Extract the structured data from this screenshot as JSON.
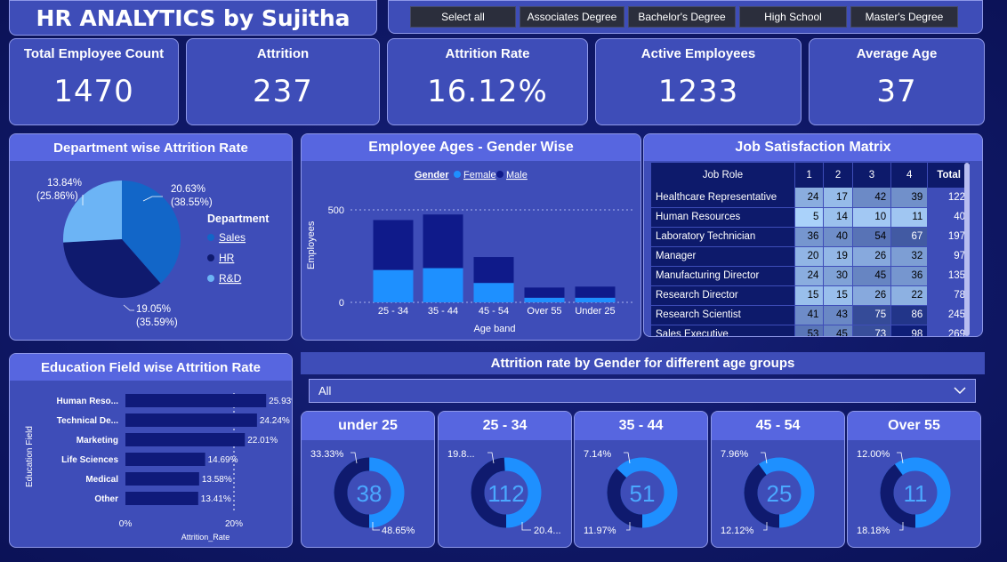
{
  "header": {
    "title": "HR ANALYTICS by Sujitha"
  },
  "slicer": {
    "items": [
      "Select all",
      "Associates Degree",
      "Bachelor's Degree",
      "High School",
      "Master's Degree"
    ]
  },
  "kpis": [
    {
      "label": "Total Employee Count",
      "value": "1470"
    },
    {
      "label": "Attrition",
      "value": "237"
    },
    {
      "label": "Attrition Rate",
      "value": "16.12%"
    },
    {
      "label": "Active Employees",
      "value": "1233"
    },
    {
      "label": "Average Age",
      "value": "37"
    }
  ],
  "dept_chart": {
    "title": "Department wise Attrition Rate",
    "legend_title": "Department",
    "legend": [
      {
        "name": "Sales",
        "color": "#1266c8"
      },
      {
        "name": "HR",
        "color": "#0f1a6e"
      },
      {
        "name": "R&D",
        "color": "#6cb4f5"
      }
    ],
    "labels": {
      "sales": [
        "20.63%",
        "(38.55%)"
      ],
      "hr": [
        "19.05%",
        "(35.59%)"
      ],
      "rnd": [
        "13.84%",
        "(25.86%)"
      ]
    }
  },
  "age_chart": {
    "title": "Employee Ages - Gender Wise",
    "legend_title": "Gender",
    "legend": [
      {
        "name": "Female",
        "color": "#1e90ff"
      },
      {
        "name": "Male",
        "color": "#0f1a8a"
      }
    ],
    "ylabel": "Employees",
    "xlabel": "Age band",
    "yticks": [
      "0",
      "500"
    ]
  },
  "matrix": {
    "title": "Job Satisfaction Matrix",
    "columns": [
      "Job Role",
      "1",
      "2",
      "3",
      "4",
      "Total"
    ],
    "rows": [
      [
        "Healthcare Representative",
        "24",
        "17",
        "42",
        "39",
        "122"
      ],
      [
        "Human Resources",
        "5",
        "14",
        "10",
        "11",
        "40"
      ],
      [
        "Laboratory Technician",
        "36",
        "40",
        "54",
        "67",
        "197"
      ],
      [
        "Manager",
        "20",
        "19",
        "26",
        "32",
        "97"
      ],
      [
        "Manufacturing Director",
        "24",
        "30",
        "45",
        "36",
        "135"
      ],
      [
        "Research Director",
        "15",
        "15",
        "26",
        "22",
        "78"
      ],
      [
        "Research Scientist",
        "41",
        "43",
        "75",
        "86",
        "245"
      ],
      [
        "Sales Executive",
        "53",
        "45",
        "73",
        "98",
        "269"
      ]
    ]
  },
  "edu_chart": {
    "title": "Education Field wise Attrition Rate",
    "ylabel": "Education Field",
    "xlabel": "Attrition_Rate",
    "xticks": [
      "0%",
      "20%"
    ]
  },
  "gender_section": {
    "title": "Attrition rate by Gender for different age groups",
    "dropdown_value": "All"
  },
  "gauges": [
    {
      "title": "under 25",
      "center": "38",
      "label_left": "33.33%",
      "label_right": "48.65%",
      "male_share": 0.5
    },
    {
      "title": "25 - 34",
      "center": "112",
      "label_left": "19.8...",
      "label_right": "20.4...",
      "male_share": 0.49
    },
    {
      "title": "35 - 44",
      "center": "51",
      "label_left": "7.14%",
      "label_right": "11.97%",
      "male_share": 0.37
    },
    {
      "title": "45 - 54",
      "center": "25",
      "label_left": "7.96%",
      "label_right": "12.12%",
      "male_share": 0.4
    },
    {
      "title": "Over 55",
      "center": "11",
      "label_left": "12.00%",
      "label_right": "18.18%",
      "male_share": 0.4
    }
  ],
  "chart_data": [
    {
      "type": "pie",
      "title": "Department wise Attrition Rate",
      "categories": [
        "Sales",
        "HR",
        "R&D"
      ],
      "values": [
        20.63,
        19.05,
        13.84
      ],
      "shares": [
        38.55,
        35.59,
        25.86
      ],
      "legend": "right"
    },
    {
      "type": "bar",
      "title": "Employee Ages - Gender Wise",
      "categories": [
        "25 - 34",
        "35 - 44",
        "45 - 54",
        "Over 55",
        "Under 25"
      ],
      "series": [
        {
          "name": "Female",
          "values": [
            175,
            185,
            105,
            25,
            25
          ]
        },
        {
          "name": "Male",
          "values": [
            270,
            290,
            140,
            55,
            60
          ]
        }
      ],
      "xlabel": "Age band",
      "ylabel": "Employees",
      "ylim": [
        0,
        500
      ]
    },
    {
      "type": "bar",
      "title": "Education Field wise Attrition Rate",
      "categories": [
        "Human Reso...",
        "Technical De...",
        "Marketing",
        "Life Sciences",
        "Medical",
        "Other"
      ],
      "values": [
        25.93,
        24.24,
        22.01,
        14.69,
        13.58,
        13.41
      ],
      "value_labels": [
        "25.93%",
        "24.24%",
        "22.01%",
        "14.69%",
        "13.58%",
        "13.41%"
      ],
      "xlabel": "Attrition_Rate",
      "ylabel": "Education Field"
    }
  ]
}
